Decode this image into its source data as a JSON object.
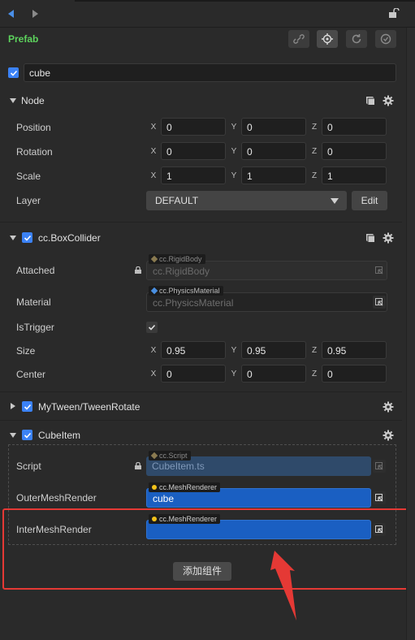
{
  "header": {
    "title": "Prefab"
  },
  "node": {
    "active": true,
    "name": "cube"
  },
  "node_section": {
    "title": "Node",
    "position": {
      "label": "Position",
      "x": "0",
      "y": "0",
      "z": "0"
    },
    "rotation": {
      "label": "Rotation",
      "x": "0",
      "y": "0",
      "z": "0"
    },
    "scale": {
      "label": "Scale",
      "x": "1",
      "y": "1",
      "z": "1"
    },
    "layer": {
      "label": "Layer",
      "value": "DEFAULT",
      "edit_label": "Edit"
    },
    "axis_labels": {
      "x": "X",
      "y": "Y",
      "z": "Z"
    }
  },
  "box_collider": {
    "title": "cc.BoxCollider",
    "attached": {
      "label": "Attached",
      "tag": "cc.RigidBody",
      "placeholder": "cc.RigidBody"
    },
    "material": {
      "label": "Material",
      "tag": "cc.PhysicsMaterial",
      "placeholder": "cc.PhysicsMaterial"
    },
    "is_trigger": {
      "label": "IsTrigger",
      "checked": true
    },
    "size": {
      "label": "Size",
      "x": "0.95",
      "y": "0.95",
      "z": "0.95"
    },
    "center": {
      "label": "Center",
      "x": "0",
      "y": "0",
      "z": "0"
    }
  },
  "tween_rotate": {
    "title": "MyTween/TweenRotate"
  },
  "cube_item": {
    "title": "CubeItem",
    "script": {
      "label": "Script",
      "tag": "cc.Script",
      "value": "CubeItem.ts"
    },
    "outer_mesh": {
      "label": "OuterMeshRender",
      "tag": "cc.MeshRenderer",
      "value": "cube"
    },
    "inter_mesh": {
      "label": "InterMeshRender",
      "tag": "cc.MeshRenderer",
      "value": ""
    }
  },
  "add_component_label": "添加组件",
  "colors": {
    "accent_blue": "#1a5fc2",
    "highlight_red": "#e53935",
    "prefab_green": "#5dd35d"
  }
}
